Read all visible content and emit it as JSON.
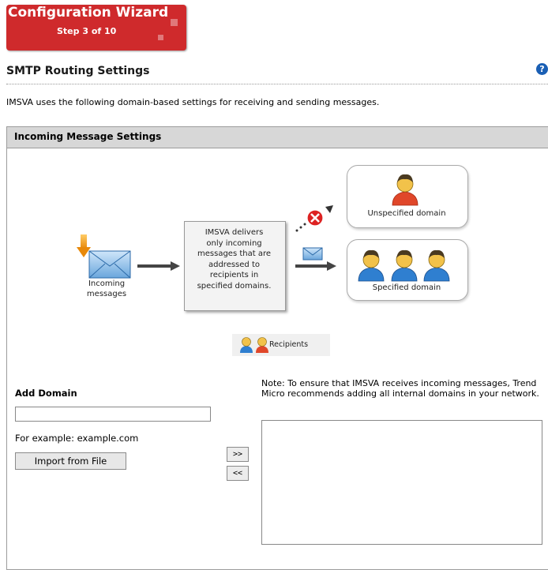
{
  "wizard": {
    "title": "Configuration Wizard",
    "step": "Step 3 of 10"
  },
  "page": {
    "title": "SMTP Routing Settings",
    "help_icon": "question-circle-icon",
    "intro": "IMSVA uses the following domain-based settings for receiving and sending messages."
  },
  "section": {
    "title": "Incoming Message Settings",
    "diagram": {
      "incoming_label_line1": "Incoming",
      "incoming_label_line2": "messages",
      "center_lines": [
        "IMSVA delivers",
        "only incoming",
        "messages that are",
        "addressed to",
        "recipients in",
        "specified domains."
      ],
      "unspecified_label": "Unspecified domain",
      "specified_label": "Specified domain",
      "legend_label": "Recipients"
    },
    "form": {
      "add_domain_label": "Add Domain",
      "domain_input_value": "",
      "example": "For example: example.com",
      "import_button": "Import from File",
      "add_button": ">>",
      "remove_button": "<<",
      "note": "Note: To ensure that IMSVA receives incoming messages, Trend Micro recommends adding all internal domains in your network.",
      "domains": []
    }
  },
  "colors": {
    "wizard_red": "#cf2a2c",
    "header_gray": "#d7d7d7",
    "help_blue": "#1a5fb4"
  }
}
